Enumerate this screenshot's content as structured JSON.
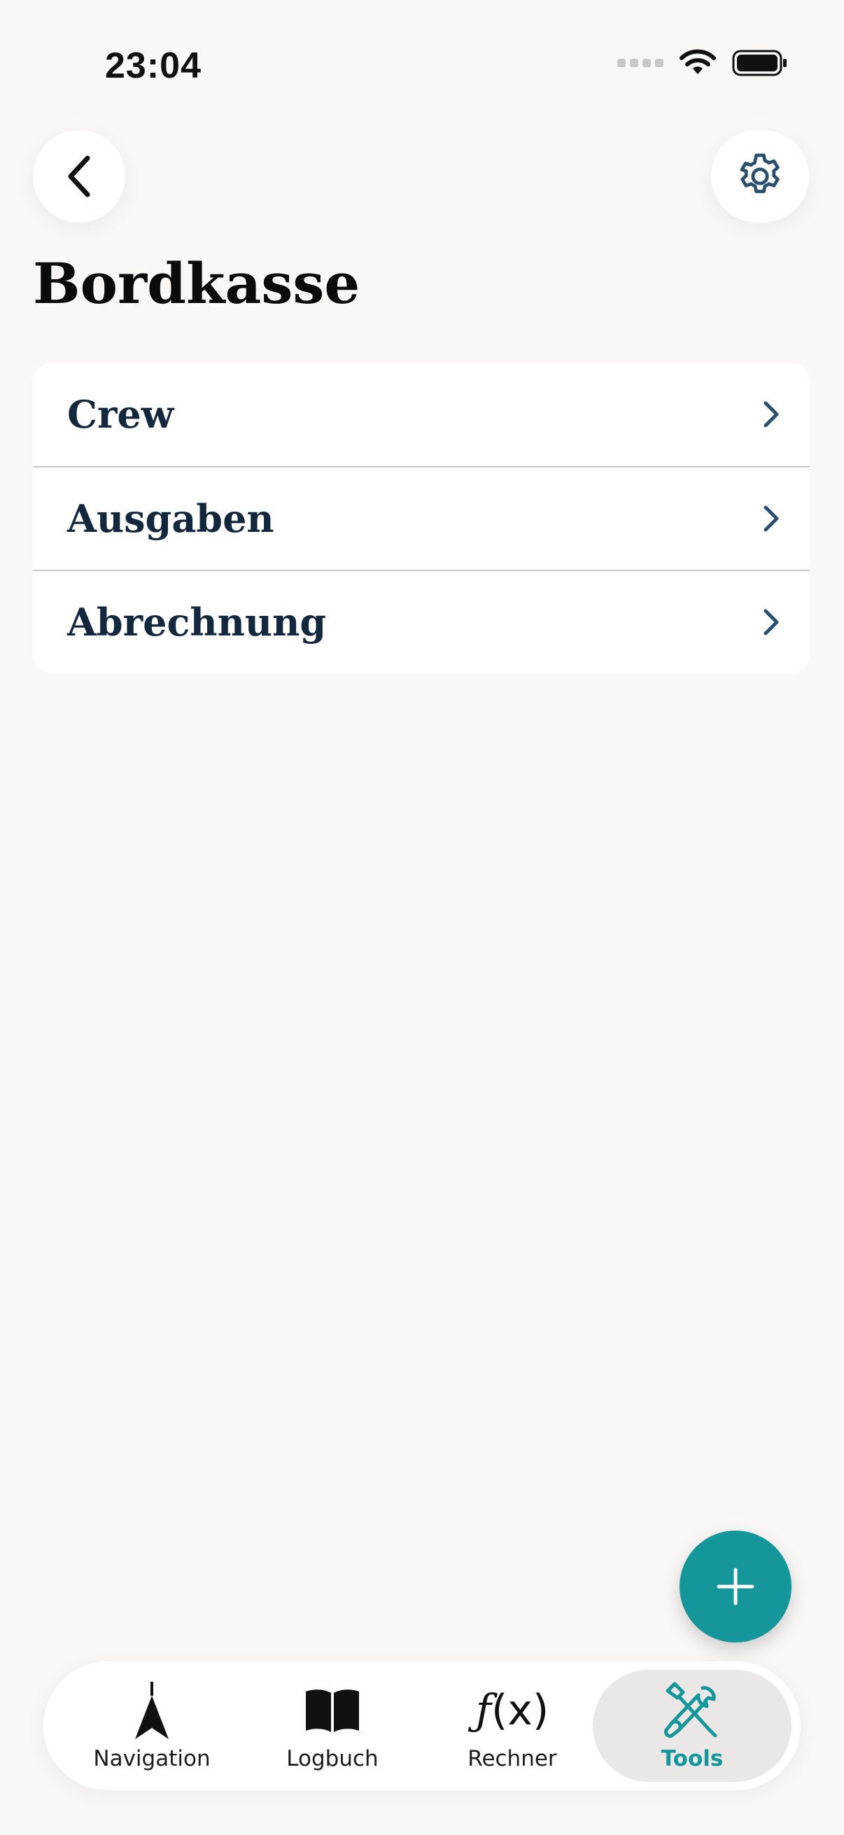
{
  "status_bar": {
    "time": "23:04"
  },
  "header": {
    "title": "Bordkasse"
  },
  "menu": {
    "items": [
      {
        "label": "Crew"
      },
      {
        "label": "Ausgaben"
      },
      {
        "label": "Abrechnung"
      }
    ]
  },
  "tab_bar": {
    "tabs": [
      {
        "label": "Navigation",
        "icon": "navigation-arrow-icon"
      },
      {
        "label": "Logbuch",
        "icon": "book-icon"
      },
      {
        "label": "Rechner",
        "icon": "function-icon"
      },
      {
        "label": "Tools",
        "icon": "tools-icon",
        "active": true
      }
    ],
    "active_color": "#14969a"
  },
  "colors": {
    "accent": "#14969a",
    "background": "#f9f8f6",
    "label": "#14283d"
  }
}
